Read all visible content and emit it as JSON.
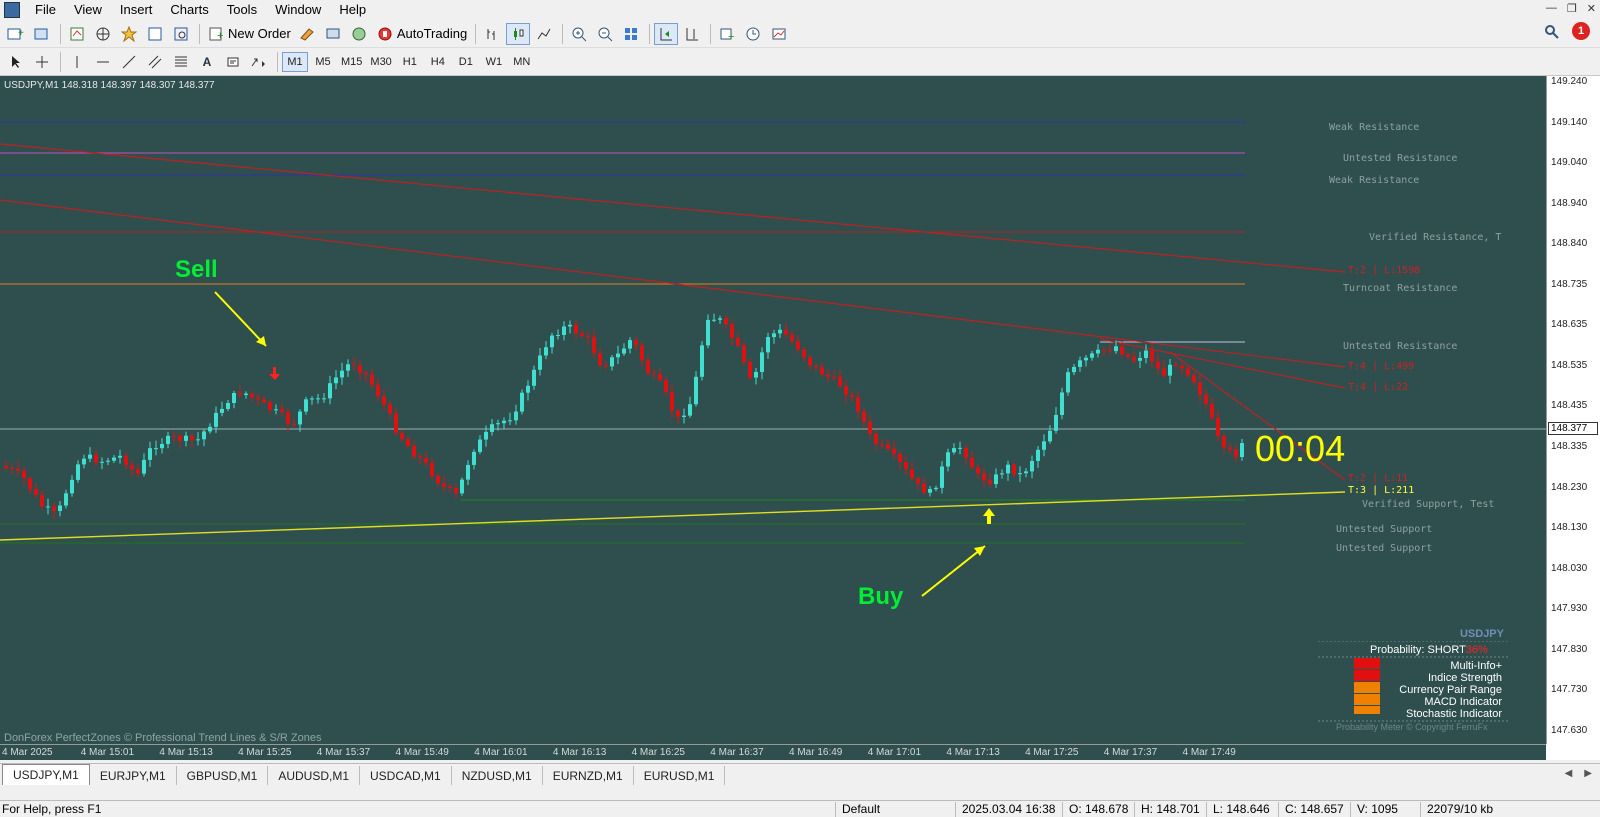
{
  "menu": [
    "File",
    "View",
    "Insert",
    "Charts",
    "Tools",
    "Window",
    "Help"
  ],
  "toolbar": {
    "new_order": "New Order",
    "autotrading": "AutoTrading",
    "notif_count": "1"
  },
  "timeframes": [
    "M1",
    "M5",
    "M15",
    "M30",
    "H1",
    "H4",
    "D1",
    "W1",
    "MN"
  ],
  "active_timeframe": "M1",
  "chart": {
    "header": "USDJPY,M1  148.318 148.397 148.307 148.377",
    "current_price": "148.377",
    "price_ticks": [
      "149.240",
      "149.140",
      "149.040",
      "148.940",
      "148.840",
      "148.735",
      "148.635",
      "148.535",
      "148.435",
      "148.335",
      "148.230",
      "148.130",
      "148.030",
      "147.930",
      "147.830",
      "147.730",
      "147.630"
    ],
    "time_ticks": [
      "4 Mar 2025",
      "4 Mar 15:01",
      "4 Mar 15:13",
      "4 Mar 15:25",
      "4 Mar 15:37",
      "4 Mar 15:49",
      "4 Mar 16:01",
      "4 Mar 16:13",
      "4 Mar 16:25",
      "4 Mar 16:37",
      "4 Mar 16:49",
      "4 Mar 17:01",
      "4 Mar 17:13",
      "4 Mar 17:25",
      "4 Mar 17:37",
      "4 Mar 17:49"
    ],
    "zones": {
      "z1": "Weak Resistance",
      "z2": "Untested Resistance",
      "z3": "Weak Resistance",
      "z4": "Verified Resistance, T",
      "z5": "Turncoat Resistance",
      "z6": "Untested Resistance",
      "z7": "Verified Support, Test",
      "z8": "Untested Support",
      "z9": "Untested Support"
    },
    "trendlines": {
      "t1": "T:2 | L:1598",
      "t2": "T:4 | L:499",
      "t3": "T:4 | L:22",
      "t4": "T:2 | L:11",
      "t5": "T:3 | L:211"
    },
    "sell_label": "Sell",
    "buy_label": "Buy",
    "timer": "00:04",
    "credit": "DonForex PerfectZones © Professional Trend Lines & S/R Zones",
    "colors": {
      "background": "#2f4f4f",
      "bull": "#40e0d0",
      "bear": "#dd1111",
      "signal": "#ffff00",
      "label": "#00ee33"
    }
  },
  "probability_panel": {
    "symbol": "USDJPY",
    "prob_label": "Probability:",
    "direction": "SHORT",
    "percent": "36%",
    "rows": [
      "Multi-Info+",
      "Indice Strength",
      "Currency Pair Range",
      "MACD Indicator",
      "Stochastic Indicator"
    ],
    "copyright": "Probability Meter © Copyright FerruFx"
  },
  "tabs": [
    "USDJPY,M1",
    "EURJPY,M1",
    "GBPUSD,M1",
    "AUDUSD,M1",
    "USDCAD,M1",
    "NZDUSD,M1",
    "EURNZD,M1",
    "EURUSD,M1"
  ],
  "active_tab": "USDJPY,M1",
  "status": {
    "help": "For Help, press F1",
    "profile": "Default",
    "datetime": "2025.03.04 16:38",
    "open": "O: 148.678",
    "high": "H: 148.701",
    "low": "L: 148.646",
    "close": "C: 148.657",
    "volume": "V: 1095",
    "traffic": "22079/10 kb"
  }
}
